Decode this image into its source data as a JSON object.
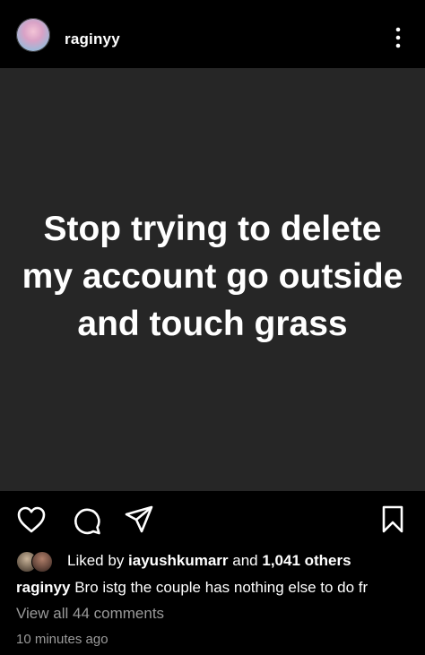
{
  "header": {
    "username": "raginyy",
    "avatar_icon": "profile-avatar",
    "more_icon": "vertical-ellipsis-icon"
  },
  "post": {
    "text": "Stop trying to delete my account go outside and touch grass",
    "background_color": "#262626"
  },
  "actions": {
    "like_icon": "heart-icon",
    "comment_icon": "comment-bubble-icon",
    "share_icon": "paper-plane-icon",
    "save_icon": "bookmark-icon"
  },
  "likes": {
    "prefix": "Liked by ",
    "user": "iayushkumarr",
    "middle": " and ",
    "count": "1,041 others"
  },
  "caption": {
    "username": "raginyy",
    "text": " Bro istg the couple has nothing else to do fr"
  },
  "comments": {
    "view_all": "View all 44 comments"
  },
  "timestamp": "10 minutes ago",
  "colors": {
    "background": "#000000",
    "text_primary": "#ffffff",
    "text_secondary": "#9a9a9a"
  }
}
